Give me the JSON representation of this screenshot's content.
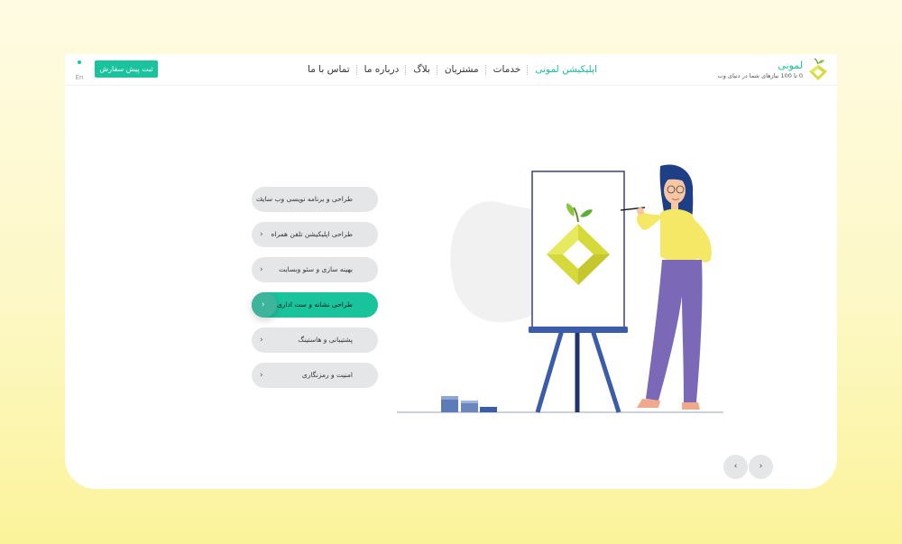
{
  "brand": {
    "name": "لمونی",
    "tagline": "0 تا 100 نیازهای شما در دنیای وب"
  },
  "nav": {
    "items": [
      {
        "label": "اپلیکیشن لمونی",
        "active": true
      },
      {
        "label": "خدمات",
        "active": false
      },
      {
        "label": "مشتریان",
        "active": false
      },
      {
        "label": "بلاگ",
        "active": false
      },
      {
        "label": "درباره ما",
        "active": false
      },
      {
        "label": "تماس با ما",
        "active": false
      }
    ]
  },
  "order_button": {
    "label": "ثبت پیش سفارش"
  },
  "language": {
    "label": "En"
  },
  "services": {
    "items": [
      {
        "label": "طراحی و برنامه نویسی وب سایت",
        "active": false
      },
      {
        "label": "طراحی اپلیکیشن تلفن همراه",
        "active": false
      },
      {
        "label": "بهینه سازی و سئو وبسایت",
        "active": false
      },
      {
        "label": "طراحی نشانه و ست اداری",
        "active": true
      },
      {
        "label": "پشتیبانی و هاستینگ",
        "active": false
      },
      {
        "label": "امنیت و رمزنگاری",
        "active": false
      }
    ],
    "chevron": "›"
  },
  "pager": {
    "prev": "‹",
    "next": "›"
  },
  "icons": {
    "logo": "lemon-logo-icon",
    "chevron": "chevron-right-icon",
    "language": "dot-icon"
  },
  "colors": {
    "accent": "#19c39b",
    "lemon": "#d6d93a",
    "leaf": "#8cc63f",
    "easel": "#3b5ca8",
    "hair": "#1e3f86",
    "shirt": "#f4e866",
    "pants": "#7b69b8",
    "blob": "#f1f1f2"
  }
}
